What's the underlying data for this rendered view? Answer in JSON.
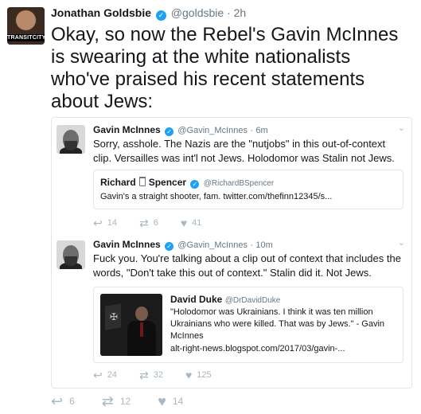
{
  "tweet": {
    "avatar_badge": "TRANSITCITY",
    "name": "Jonathan Goldsbie",
    "handle": "@goldsbie",
    "time": "2h",
    "text": "Okay, so now the Rebel's Gavin McInnes is swearing at the white nationalists who've praised his recent statements about Jews:",
    "actions": {
      "reply_count": "6",
      "retweet_count": "12",
      "like_count": "14"
    }
  },
  "quoted_1": {
    "name": "Gavin McInnes",
    "handle": "@Gavin_McInnes",
    "time": "6m",
    "text": "Sorry, asshole. The Nazis are the \"nutjobs\" in this out-of-context clip. Versailles was int'l not Jews. Holodomor was Stalin not Jews.",
    "inner": {
      "name_first": "Richard",
      "name_last": "Spencer",
      "handle": "@RichardBSpencer",
      "text": "Gavin's a straight shooter, fam. twitter.com/thefinn12345/s..."
    },
    "actions": {
      "reply_count": "14",
      "retweet_count": "6",
      "like_count": "41"
    }
  },
  "quoted_2": {
    "name": "Gavin McInnes",
    "handle": "@Gavin_McInnes",
    "time": "10m",
    "text": "Fuck you. You're talking about a clip out of context that includes the words, \"Don't take this out of context.\" Stalin did it. Not Jews.",
    "inner": {
      "name": "David Duke",
      "handle": "@DrDavidDuke",
      "text": "\"Holodomor was Ukrainians. I think it was ten million Ukrainians who were killed. That was by Jews.\" - Gavin McInnes",
      "link": "alt-right-news.blogspot.com/2017/03/gavin-..."
    },
    "actions": {
      "reply_count": "24",
      "retweet_count": "32",
      "like_count": "125"
    }
  },
  "icons": {
    "reply": "↩",
    "retweet": "⇄",
    "like": "♥",
    "verified": "✓",
    "caret": "⌄"
  },
  "colors": {
    "verified_blue": "#1da1f2",
    "meta_gray": "#657786",
    "action_gray": "#aab8c2",
    "border": "#e1e8ed"
  }
}
